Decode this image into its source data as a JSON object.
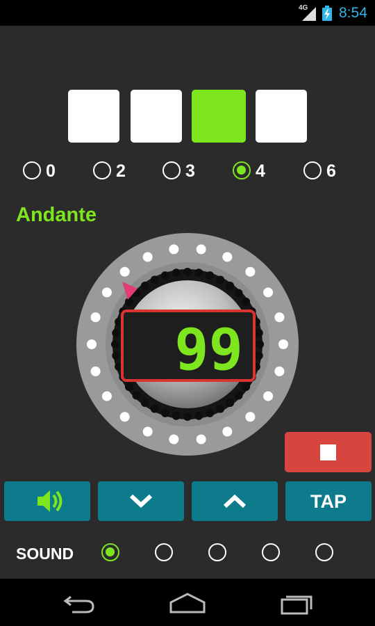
{
  "status_bar": {
    "network": "4G",
    "time": "8:54",
    "icons": [
      "signal-icon",
      "battery-charging-icon"
    ]
  },
  "beats": {
    "boxes": [
      {
        "state": "off"
      },
      {
        "state": "off"
      },
      {
        "state": "on"
      },
      {
        "state": "off"
      }
    ],
    "options": [
      {
        "label": "0",
        "selected": false
      },
      {
        "label": "2",
        "selected": false
      },
      {
        "label": "3",
        "selected": false
      },
      {
        "label": "4",
        "selected": true
      },
      {
        "label": "6",
        "selected": false
      }
    ]
  },
  "tempo": {
    "name": "Andante",
    "bpm": "99"
  },
  "controls": {
    "stop_icon": "stop-icon",
    "sound_icon": "speaker-icon",
    "down_icon": "chevron-down-icon",
    "up_icon": "chevron-up-icon",
    "tap_label": "TAP"
  },
  "sound": {
    "label": "SOUND",
    "options": [
      {
        "selected": true
      },
      {
        "selected": false
      },
      {
        "selected": false
      },
      {
        "selected": false
      },
      {
        "selected": false
      }
    ]
  },
  "nav": {
    "icons": [
      "back-icon",
      "home-icon",
      "recent-apps-icon"
    ]
  },
  "colors": {
    "accent": "#7ee61e",
    "button": "#0e7b8c",
    "stop": "#d6463e",
    "lcd_border": "#d9342f",
    "status_clock": "#33b5e5"
  }
}
